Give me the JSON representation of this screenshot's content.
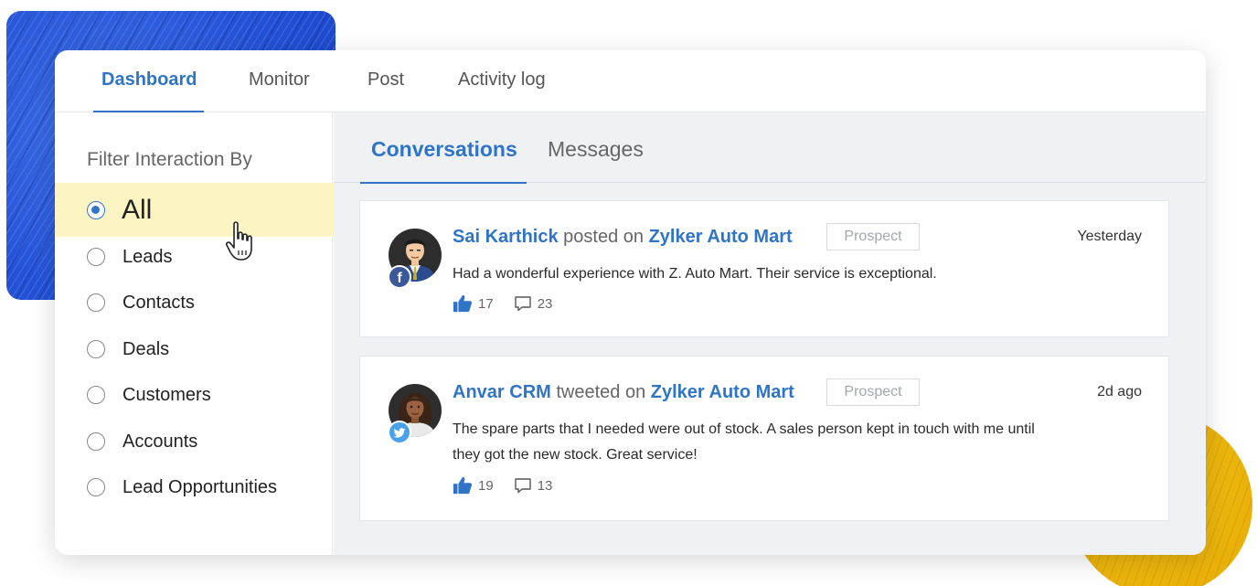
{
  "nav": {
    "tabs": [
      {
        "label": "Dashboard",
        "active": true
      },
      {
        "label": "Monitor",
        "active": false
      },
      {
        "label": "Post",
        "active": false
      },
      {
        "label": "Activity log",
        "active": false
      }
    ]
  },
  "sidebar": {
    "title": "Filter Interaction By",
    "options": [
      {
        "label": "All",
        "selected": true
      },
      {
        "label": "Leads",
        "selected": false
      },
      {
        "label": "Contacts",
        "selected": false
      },
      {
        "label": "Deals",
        "selected": false
      },
      {
        "label": "Customers",
        "selected": false
      },
      {
        "label": "Accounts",
        "selected": false
      },
      {
        "label": "Lead Opportunities",
        "selected": false
      }
    ]
  },
  "content": {
    "tabs": [
      {
        "label": "Conversations",
        "active": true
      },
      {
        "label": "Messages",
        "active": false
      }
    ],
    "posts": [
      {
        "author": "Sai Karthick",
        "action": "posted on",
        "page": "Zylker Auto Mart",
        "badge": "Prospect",
        "time": "Yesterday",
        "network_icon": "facebook-icon",
        "body": "Had a wonderful experience with Z. Auto Mart. Their service is exceptional.",
        "likes": "17",
        "comments": "23"
      },
      {
        "author": "Anvar CRM",
        "action": "tweeted on",
        "page": "Zylker Auto Mart",
        "badge": "Prospect",
        "time": "2d ago",
        "network_icon": "twitter-icon",
        "body": "The spare parts that I needed were out of stock. A sales person kept in touch with me until they got the new stock. Great service!",
        "likes": "19",
        "comments": "13"
      }
    ]
  },
  "colors": {
    "accent": "#2f74c7",
    "selected_bg": "#fdf4c4",
    "facebook": "#3b5998",
    "twitter": "#4aa1eb",
    "content_bg": "#eff1f5"
  }
}
